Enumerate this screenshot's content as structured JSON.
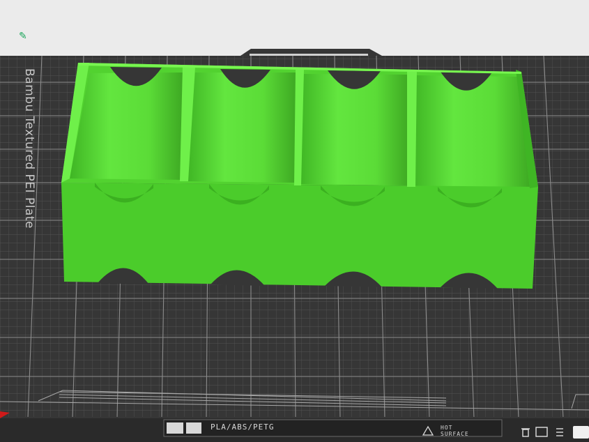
{
  "bed": {
    "plate_name": "Bambu Textured PEI Plate",
    "filament_types": "PLA/ABS/PETG",
    "hot_surface_line1": "HOT",
    "hot_surface_line2": "SURFACE"
  },
  "colors": {
    "background": "#ebebeb",
    "plate": "#363636",
    "grid": "#8a8a8a",
    "model": "#5fe33c",
    "model_dark": "#4cc82a",
    "edit_icon": "#1aa55a"
  },
  "icons": {
    "edit": "pencil-icon",
    "view_tools": [
      "trash-icon",
      "square-icon",
      "list-icon"
    ]
  }
}
